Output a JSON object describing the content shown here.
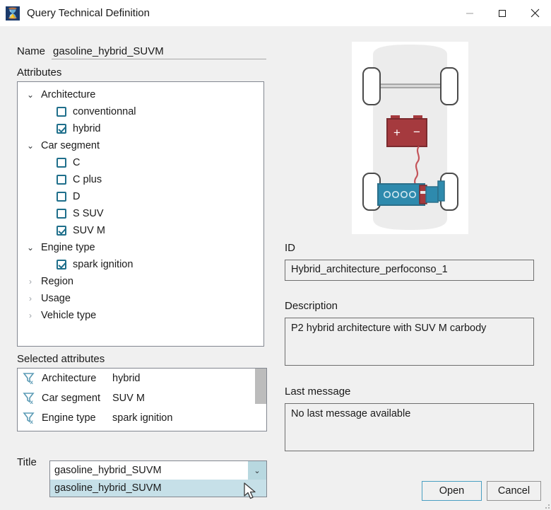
{
  "window": {
    "title": "Query Technical Definition",
    "app_icon": "app-logo-icon",
    "minimize": "–",
    "maximize": "□",
    "close": "✕"
  },
  "form": {
    "name_label": "Name",
    "name_value": "gasoline_hybrid_SUVM",
    "name_placeholder": "",
    "attributes_label": "Attributes",
    "selected_label": "Selected attributes",
    "title_label": "Title"
  },
  "tree": {
    "groups": [
      {
        "label": "Architecture",
        "expanded": true,
        "twisty": "⌄",
        "children": [
          {
            "label": "conventionnal",
            "checked": false
          },
          {
            "label": "hybrid",
            "checked": true
          }
        ]
      },
      {
        "label": "Car segment",
        "expanded": true,
        "twisty": "⌄",
        "children": [
          {
            "label": "C",
            "checked": false
          },
          {
            "label": "C plus",
            "checked": false
          },
          {
            "label": "D",
            "checked": false
          },
          {
            "label": "S SUV",
            "checked": false
          },
          {
            "label": "SUV M",
            "checked": true
          }
        ]
      },
      {
        "label": "Engine type",
        "expanded": true,
        "twisty": "⌄",
        "children": [
          {
            "label": "spark ignition",
            "checked": true
          }
        ]
      },
      {
        "label": "Region",
        "expanded": false,
        "twisty": "›",
        "children": []
      },
      {
        "label": "Usage",
        "expanded": false,
        "twisty": "›",
        "children": []
      },
      {
        "label": "Vehicle type",
        "expanded": false,
        "twisty": "›",
        "children": []
      }
    ]
  },
  "selected_attributes": {
    "rows": [
      {
        "icon": "filter-remove-icon",
        "key": "Architecture",
        "value": "hybrid"
      },
      {
        "icon": "filter-remove-icon",
        "key": "Car segment",
        "value": "SUV M"
      },
      {
        "icon": "filter-remove-icon",
        "key": "Engine type",
        "value": "spark ignition"
      }
    ]
  },
  "title_combo": {
    "value": "gasoline_hybrid_SUVM",
    "arrow": "⌄",
    "options": [
      {
        "label": "gasoline_hybrid_SUVM",
        "highlighted": true
      }
    ]
  },
  "details": {
    "id_label": "ID",
    "id_value": "Hybrid_architecture_perfoconso_1",
    "description_label": "Description",
    "description_value": "P2 hybrid architecture with SUV M carbody",
    "last_message_label": "Last message",
    "last_message_value": "No last message available"
  },
  "illustration": {
    "name": "hybrid-car-topview-diagram",
    "battery_plus": "+",
    "battery_minus": "−"
  },
  "buttons": {
    "open": "Open",
    "cancel": "Cancel"
  },
  "colors": {
    "accent_checkbox": "#1f6f8b",
    "battery_red": "#a53a3e",
    "engine_teal": "#2e8aad",
    "highlight": "#c6e0e8",
    "default_button_border": "#4a9fc2"
  }
}
